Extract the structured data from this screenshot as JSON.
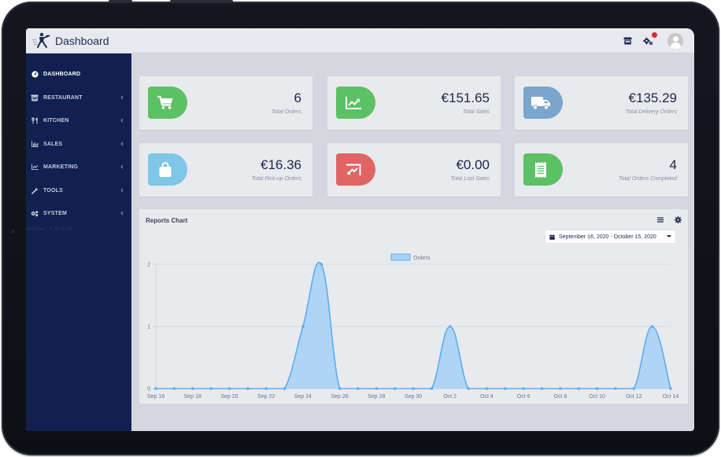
{
  "header": {
    "title": "Dashboard",
    "icons": [
      "store-icon",
      "gears-icon",
      "user-avatar"
    ],
    "notification_dot_color": "#e0262d"
  },
  "sidebar": {
    "items": [
      {
        "label": "DASHBOARD",
        "icon": "dashboard-gauge-icon",
        "active": true,
        "has_submenu": false
      },
      {
        "label": "RESTAURANT",
        "icon": "store-icon",
        "active": false,
        "has_submenu": true
      },
      {
        "label": "KITCHEN",
        "icon": "utensils-icon",
        "active": false,
        "has_submenu": true
      },
      {
        "label": "SALES",
        "icon": "bar-chart-icon",
        "active": false,
        "has_submenu": true
      },
      {
        "label": "MARKETING",
        "icon": "line-chart-icon",
        "active": false,
        "has_submenu": true
      },
      {
        "label": "TOOLS",
        "icon": "wrench-icon",
        "active": false,
        "has_submenu": true
      },
      {
        "label": "SYSTEM",
        "icon": "cogs-icon",
        "active": false,
        "has_submenu": true
      }
    ],
    "version": "Version : 1.20.0-a3"
  },
  "cards": [
    {
      "value": "6",
      "label": "Total Orders",
      "icon": "shopping-cart-icon",
      "color": "#5cc165"
    },
    {
      "value": "€151.65",
      "label": "Total Sales",
      "icon": "chart-up-icon",
      "color": "#5cc165"
    },
    {
      "value": "€135.29",
      "label": "Total Delivery Orders",
      "icon": "truck-icon",
      "color": "#7aa5cc"
    },
    {
      "value": "€16.36",
      "label": "Total Pick-up Orders",
      "icon": "shopping-bag-icon",
      "color": "#7ec7e6"
    },
    {
      "value": "€0.00",
      "label": "Total Lost Sales",
      "icon": "chart-down-icon",
      "color": "#e06464"
    },
    {
      "value": "4",
      "label": "Total Orders Completed",
      "icon": "receipt-icon",
      "color": "#5cc165"
    }
  ],
  "reports": {
    "title": "Reports Chart",
    "date_range": "September 16, 2020 - October 15, 2020"
  },
  "chart_data": {
    "type": "area",
    "title": "",
    "legend": {
      "entries": [
        "Orders"
      ],
      "position": "top"
    },
    "series": [
      {
        "name": "Orders",
        "color": "#5aaef0",
        "fill": "#a9d1f5",
        "values": [
          0,
          0,
          0,
          0,
          0,
          0,
          0,
          0,
          1,
          2,
          0,
          0,
          0,
          0,
          0,
          0,
          1,
          0,
          0,
          0,
          0,
          0,
          0,
          0,
          0,
          0,
          0,
          1,
          0
        ]
      }
    ],
    "x": [
      "Sep 16",
      "Sep 17",
      "Sep 18",
      "Sep 19",
      "Sep 20",
      "Sep 21",
      "Sep 22",
      "Sep 23",
      "Sep 24",
      "Sep 25",
      "Sep 26",
      "Sep 27",
      "Sep 28",
      "Sep 29",
      "Sep 30",
      "Oct 1",
      "Oct 2",
      "Oct 3",
      "Oct 4",
      "Oct 5",
      "Oct 6",
      "Oct 7",
      "Oct 8",
      "Oct 9",
      "Oct 10",
      "Oct 11",
      "Oct 12",
      "Oct 13",
      "Oct 14"
    ],
    "xtick_labels": [
      "Sep 16",
      "Sep 18",
      "Sep 20",
      "Sep 22",
      "Sep 24",
      "Sep 26",
      "Sep 28",
      "Sep 30",
      "Oct 2",
      "Oct 4",
      "Oct 6",
      "Oct 8",
      "Oct 10",
      "Oct 12",
      "Oct 14"
    ],
    "ytick_labels": [
      "0",
      "1",
      "2"
    ],
    "xlabel": "",
    "ylabel": "",
    "ylim": [
      0,
      2
    ],
    "grid": true
  }
}
